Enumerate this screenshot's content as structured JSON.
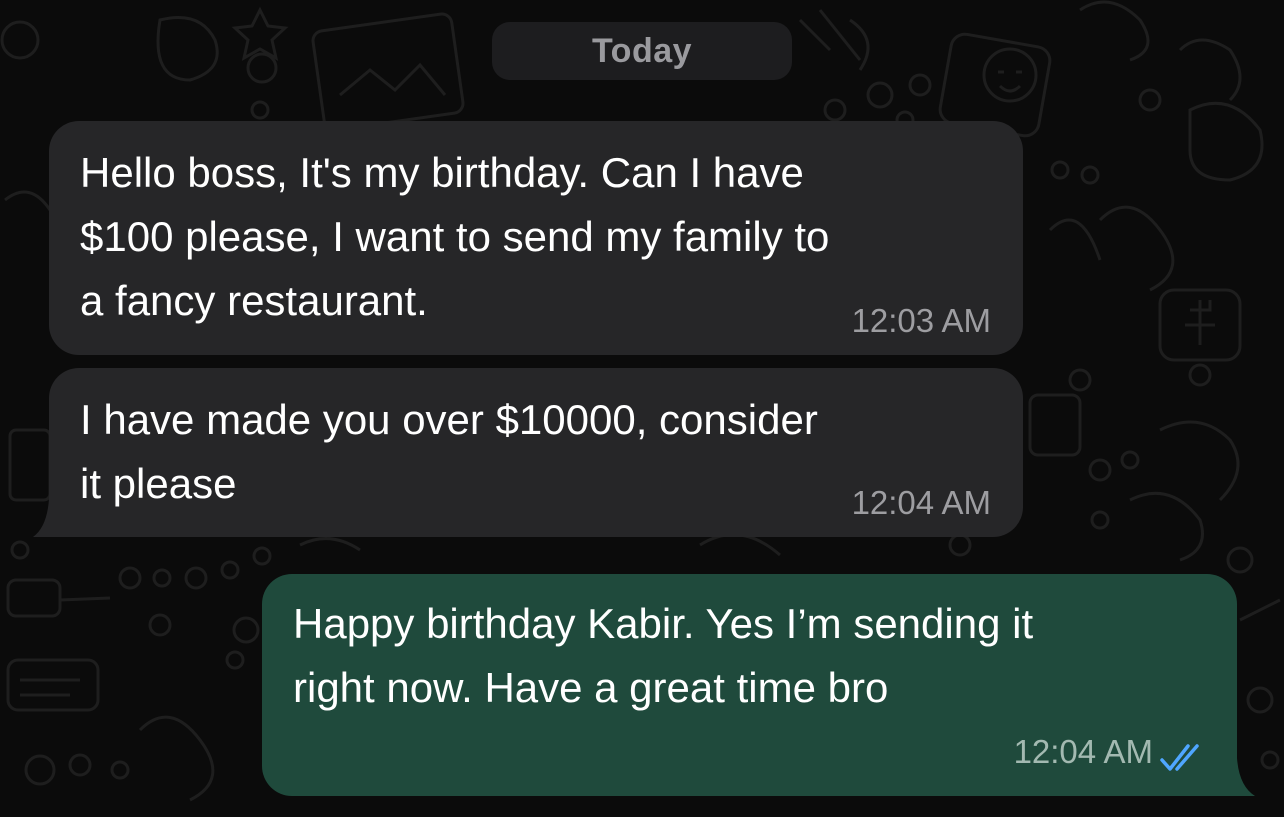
{
  "date_divider": "Today",
  "messages": [
    {
      "direction": "incoming",
      "lines": [
        "Hello boss, It's my birthday. Can I have",
        "$100 please, I want to send my family to",
        "a fancy restaurant."
      ],
      "time": "12:03 AM"
    },
    {
      "direction": "incoming",
      "lines": [
        "I have made you over $10000, consider",
        "it please"
      ],
      "time": "12:04 AM"
    },
    {
      "direction": "outgoing",
      "lines": [
        "Happy birthday Kabir. Yes I’m sending it",
        "right now. Have a great time bro"
      ],
      "time": "12:04 AM",
      "status_icon": "double-check-icon",
      "status": "read"
    }
  ],
  "colors": {
    "background": "#0b0b0b",
    "incoming_bubble": "#262628",
    "outgoing_bubble": "#1f4a3c",
    "read_ticks": "#4fa6ff"
  }
}
